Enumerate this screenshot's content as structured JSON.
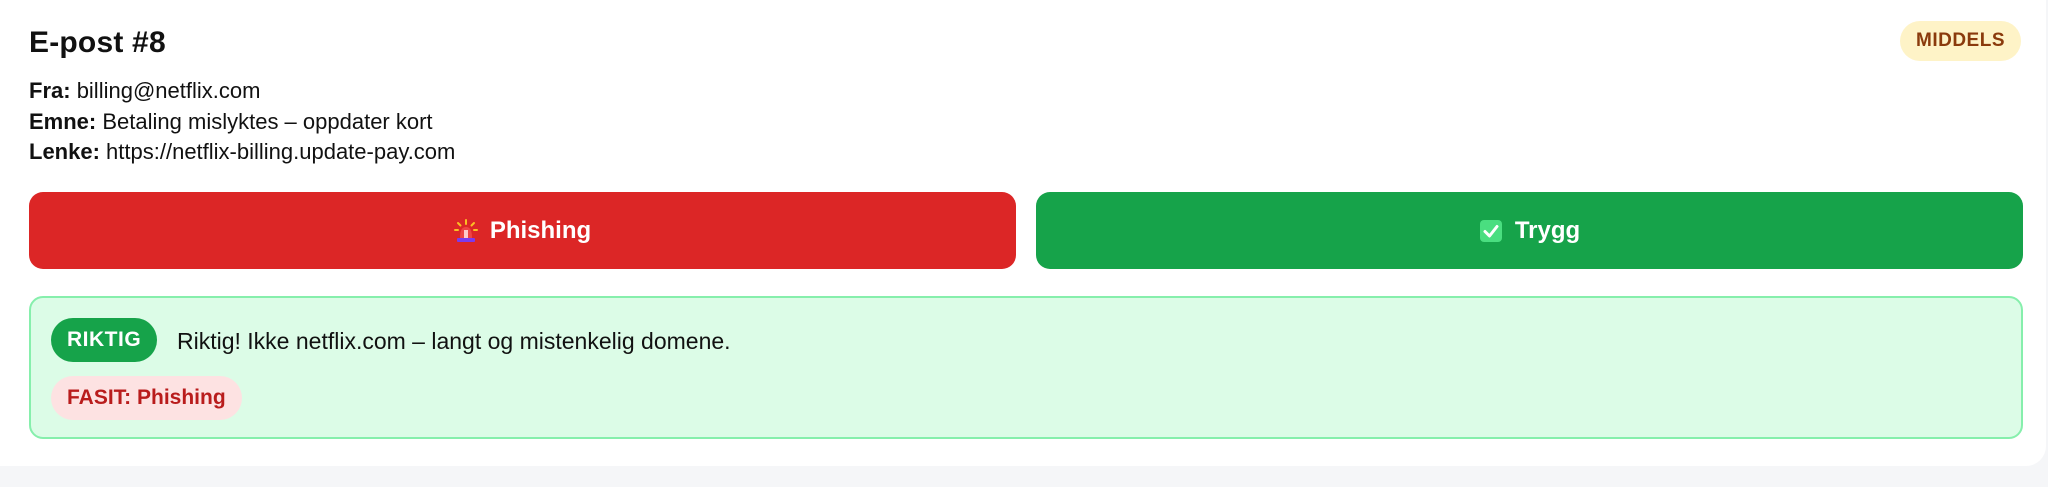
{
  "email": {
    "title": "E-post #8",
    "level": "MIDDELS",
    "from_label": "Fra:",
    "from_value": "billing@netflix.com",
    "subject_label": "Emne:",
    "subject_value": "Betaling mislyktes – oppdater kort",
    "link_label": "Lenke:",
    "link_value": "https://netflix-billing.update-pay.com"
  },
  "actions": {
    "phishing_label": "Phishing",
    "phishing_icon": "siren-icon",
    "safe_label": "Trygg",
    "safe_icon": "check-box-icon"
  },
  "result": {
    "verdict": "RIKTIG",
    "feedback": "Riktig! Ikke netflix.com – langt og mistenkelig domene.",
    "answer": "FASIT: Phishing"
  },
  "colors": {
    "phishing": "#dc2626",
    "safe": "#16a34a",
    "result_bg": "#dcfce7",
    "level_bg": "#fef3c7"
  }
}
